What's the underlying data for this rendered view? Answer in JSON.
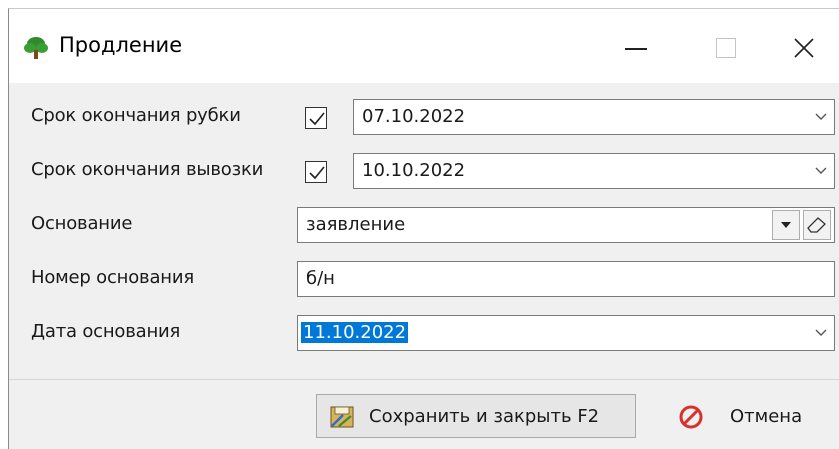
{
  "window": {
    "title": "Продление",
    "controls": {
      "minimize": "minimize",
      "maximize": "maximize",
      "close": "close"
    }
  },
  "form": {
    "cut_end": {
      "label": "Срок окончания рубки",
      "checked": true,
      "value": "07.10.2022"
    },
    "haul_end": {
      "label": "Срок окончания вывозки",
      "checked": true,
      "value": "10.10.2022"
    },
    "basis": {
      "label": "Основание",
      "value": "заявление"
    },
    "basis_number": {
      "label": "Номер основания",
      "value": "б/н"
    },
    "basis_date": {
      "label": "Дата основания",
      "value": "11.10.2022"
    }
  },
  "buttons": {
    "save_close": "Сохранить и закрыть F2",
    "cancel": "Отмена"
  },
  "icons": {
    "app": "tree-icon",
    "save": "save-close-icon",
    "cancel": "cancel-icon",
    "clear": "eraser-icon",
    "dropdown": "chevron-down-icon"
  },
  "colors": {
    "selection": "#0078d7",
    "app_icon": "#2e8b2e",
    "cancel_icon": "#d9302c"
  }
}
